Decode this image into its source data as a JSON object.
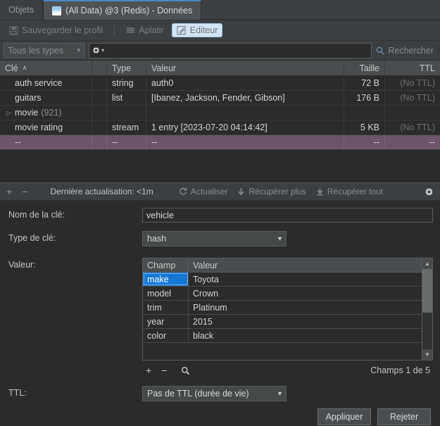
{
  "tabs": [
    {
      "label": "Objets",
      "icon": null,
      "active": false
    },
    {
      "label": "(All Data) @3 (Redis) - Données",
      "icon": "database-tab-icon",
      "active": true
    }
  ],
  "toolbar": {
    "save_profile": "Sauvegarder le profil",
    "flatten": "Aplatir",
    "editor": "Editeur"
  },
  "filterbar": {
    "type_filter": "Tous les types",
    "search_value": "",
    "search_placeholder": "",
    "search_label": "Rechercher"
  },
  "key_table": {
    "columns": [
      "Clé",
      "",
      "Type",
      "Valeur",
      "Taille",
      "TTL"
    ],
    "sort_column": "Clé",
    "sort_caret": "∧",
    "rows": [
      {
        "key": "auth service",
        "expandable": false,
        "count": "",
        "type": "string",
        "value": "auth0",
        "size": "72 B",
        "ttl": "(No TTL)",
        "ttl_muted": true,
        "selected": false
      },
      {
        "key": "guitars",
        "expandable": false,
        "count": "",
        "type": "list",
        "value": "[Ibanez, Jackson, Fender, Gibson]",
        "size": "176 B",
        "ttl": "(No TTL)",
        "ttl_muted": true,
        "selected": false
      },
      {
        "key": "movie",
        "expandable": true,
        "count": "(921)",
        "type": "",
        "value": "",
        "size": "",
        "ttl": "",
        "ttl_muted": false,
        "selected": false
      },
      {
        "key": "movie rating",
        "expandable": false,
        "count": "",
        "type": "stream",
        "value": "1 entry [2023-07-20 04:14:42]",
        "size": "5 KB",
        "ttl": "(No TTL)",
        "ttl_muted": true,
        "selected": false
      },
      {
        "key": "--",
        "expandable": false,
        "count": "",
        "type": "--",
        "value": "--",
        "size": "--",
        "ttl": "--",
        "ttl_muted": false,
        "selected": true
      }
    ]
  },
  "refresh_bar": {
    "add": "+",
    "remove": "−",
    "last_refresh": "Dernière actualisation: <1m",
    "refresh": "Actualiser",
    "fetch_more": "Récupérer plus",
    "fetch_all": "Récupérer tout",
    "settings_icon": "gear-icon"
  },
  "editor": {
    "key_name_label": "Nom de la clé:",
    "key_name_value": "vehicle",
    "key_type_label": "Type de clé:",
    "key_type_value": "hash",
    "value_label": "Valeur:",
    "ttl_label": "TTL:",
    "ttl_value": "Pas de TTL (durée de vie)",
    "fields_table": {
      "columns": [
        "Champ",
        "Valeur"
      ],
      "rows": [
        {
          "field": "make",
          "value": "Toyota",
          "selected": true
        },
        {
          "field": "model",
          "value": "Crown",
          "selected": false
        },
        {
          "field": "trim",
          "value": "Platinum",
          "selected": false
        },
        {
          "field": "year",
          "value": "2015",
          "selected": false
        },
        {
          "field": "color",
          "value": "black",
          "selected": false
        }
      ],
      "toolbar": {
        "add": "+",
        "remove": "−",
        "search_icon": "search-icon"
      },
      "count": "Champs 1 de 5"
    },
    "apply_button": "Appliquer",
    "reject_button": "Rejeter"
  },
  "colors": {
    "accent_blue": "#1578d4",
    "selected_row": "#6b5569",
    "panel": "#3c3f41",
    "background": "#2b2b2b",
    "highlight_button": "#d2e5f7"
  }
}
